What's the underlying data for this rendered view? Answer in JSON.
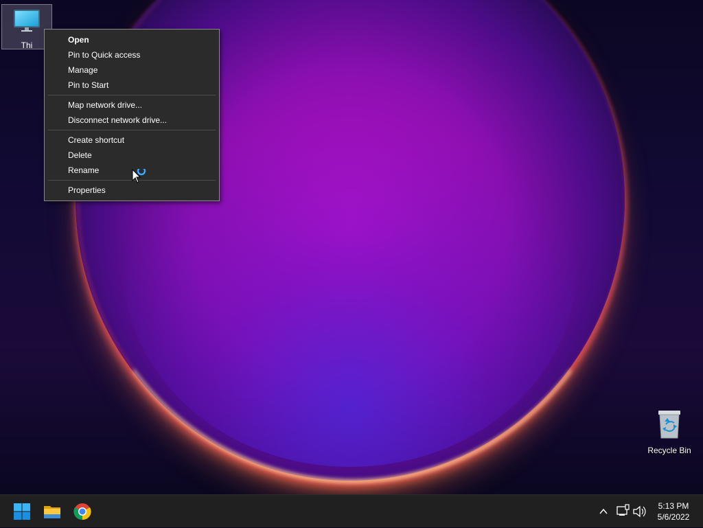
{
  "desktop": {
    "icons": [
      {
        "label": "Thi"
      },
      {
        "label": "Recycle Bin"
      }
    ]
  },
  "context_menu": {
    "groups": [
      [
        "Open",
        "Pin to Quick access",
        "Manage",
        "Pin to Start"
      ],
      [
        "Map network drive...",
        "Disconnect network drive..."
      ],
      [
        "Create shortcut",
        "Delete",
        "Rename"
      ],
      [
        "Properties"
      ]
    ],
    "default_item": "Open"
  },
  "taskbar": {
    "pinned": [
      "start-icon",
      "file-explorer-icon",
      "chrome-icon"
    ],
    "tray_icons": [
      "chevron-up-icon",
      "network-icon",
      "volume-icon"
    ],
    "time": "5:13 PM",
    "date": "5/6/2022"
  },
  "colors": {
    "menu_bg": "#2b2b2b",
    "taskbar_bg": "#202020",
    "accent": "#0a84d8"
  }
}
